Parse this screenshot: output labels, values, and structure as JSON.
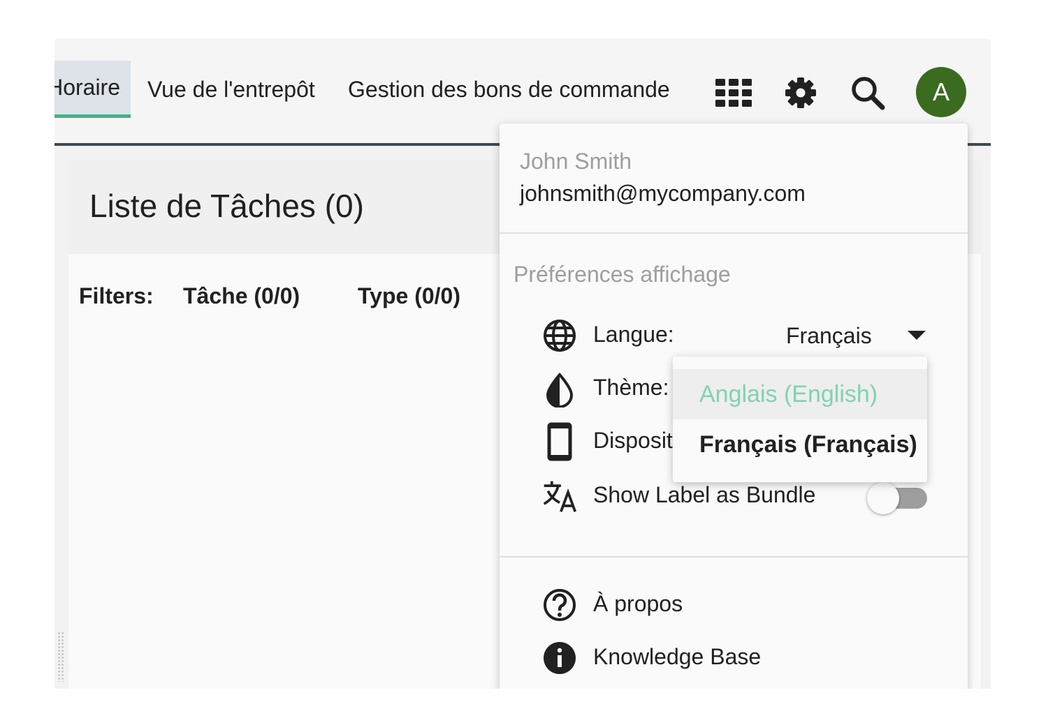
{
  "header": {
    "tabs": [
      {
        "label": "Horaire",
        "active": true
      },
      {
        "label": "Vue de l'entrepôt",
        "active": false
      },
      {
        "label": "Gestion des bons de commande",
        "active": false
      }
    ],
    "icons": {
      "apps": "apps-grid-icon",
      "settings": "gear-icon",
      "search": "search-icon"
    },
    "avatar_initial": "A",
    "avatar_color": "#3b6b1f",
    "accent_color": "#3eb489"
  },
  "main": {
    "title": "Liste de Tâches (0)",
    "filters": {
      "label": "Filters:",
      "items": [
        "Tâche (0/0)",
        "Type (0/0)"
      ]
    }
  },
  "user_menu": {
    "name": "John Smith",
    "email": "johnsmith@mycompany.com",
    "preferences": {
      "title": "Préférences affichage",
      "language": {
        "icon": "globe-icon",
        "label": "Langue:",
        "value": "Français"
      },
      "theme": {
        "icon": "contrast-drop-icon",
        "label": "Thème:"
      },
      "device": {
        "icon": "phone-icon",
        "label": "Dispositif:"
      },
      "bundle": {
        "icon": "translate-icon",
        "label": "Show Label as Bundle",
        "enabled": false
      }
    },
    "links": [
      {
        "icon": "help-icon",
        "label": "À propos"
      },
      {
        "icon": "info-icon",
        "label": "Knowledge Base"
      }
    ]
  },
  "language_dropdown": {
    "options": [
      {
        "label": "Anglais (English)",
        "selected": false,
        "color": "#7fd4ae"
      },
      {
        "label": "Français (Français)",
        "selected": true
      }
    ]
  }
}
